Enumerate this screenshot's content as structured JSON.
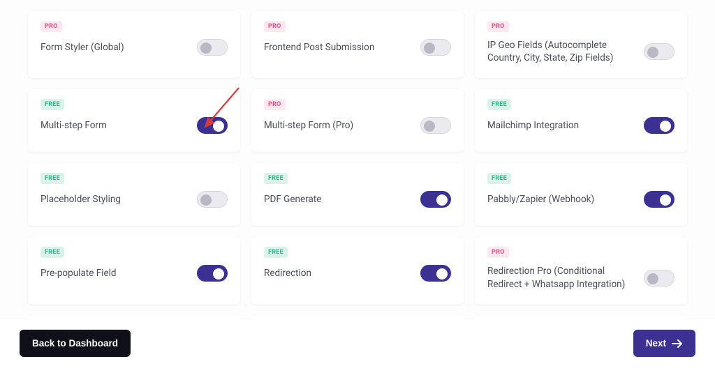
{
  "badges": {
    "pro": "PRO",
    "free": "FREE"
  },
  "cards": [
    {
      "tier": "pro",
      "title": "Form Styler (Global)",
      "on": false
    },
    {
      "tier": "pro",
      "title": "Frontend Post Submission",
      "on": false
    },
    {
      "tier": "pro",
      "title": "IP Geo Fields (Autocomplete Country, City, State, Zip Fields)",
      "on": false
    },
    {
      "tier": "free",
      "title": "Multi-step Form",
      "on": true
    },
    {
      "tier": "pro",
      "title": "Multi-step Form (Pro)",
      "on": false
    },
    {
      "tier": "free",
      "title": "Mailchimp Integration",
      "on": true
    },
    {
      "tier": "free",
      "title": "Placeholder Styling",
      "on": false
    },
    {
      "tier": "free",
      "title": "PDF Generate",
      "on": true
    },
    {
      "tier": "free",
      "title": "Pabbly/Zapier (Webhook)",
      "on": true
    },
    {
      "tier": "free",
      "title": "Pre-populate Field",
      "on": true
    },
    {
      "tier": "free",
      "title": "Redirection",
      "on": true
    },
    {
      "tier": "pro",
      "title": "Redirection Pro (Conditional Redirect + Whatsapp Integration)",
      "on": false
    },
    {
      "tier": "free",
      "title": "",
      "on": null,
      "partial": true
    },
    {
      "tier": "pro",
      "title": "",
      "on": null,
      "partial": true
    },
    {
      "tier": "pro",
      "title": "",
      "on": null,
      "partial": true
    }
  ],
  "footer": {
    "back_label": "Back to Dashboard",
    "next_label": "Next"
  },
  "colors": {
    "accent": "#3a3192",
    "pro_badge_bg": "#fde8f0",
    "pro_badge_fg": "#e84f8a",
    "free_badge_bg": "#d9f3eb",
    "free_badge_fg": "#2fb48a",
    "arrow": "#d83a3a"
  }
}
